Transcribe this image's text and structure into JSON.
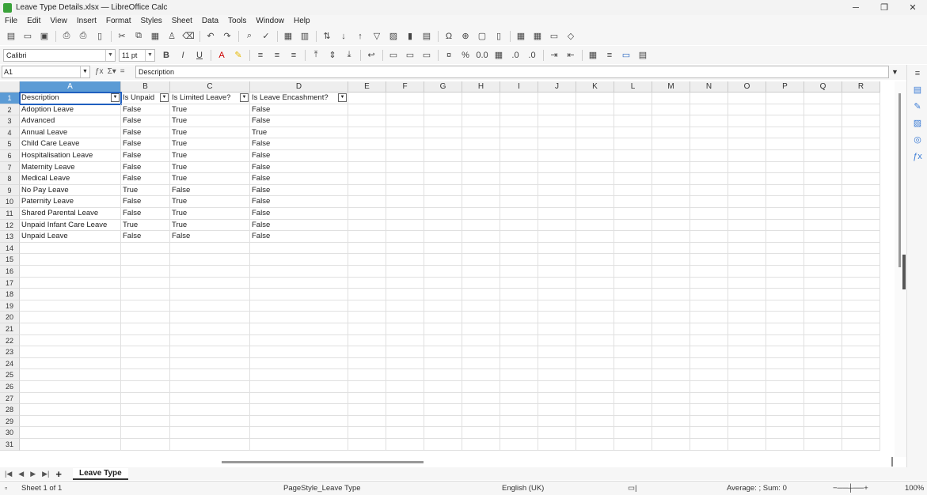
{
  "window": {
    "title": "Leave Type Details.xlsx — LibreOffice Calc"
  },
  "menu": [
    "File",
    "Edit",
    "View",
    "Insert",
    "Format",
    "Styles",
    "Sheet",
    "Data",
    "Tools",
    "Window",
    "Help"
  ],
  "format_bar": {
    "font_name": "Calibri",
    "font_size": "11 pt"
  },
  "formula_bar": {
    "cell_ref": "A1",
    "content": "Description"
  },
  "columns": [
    "A",
    "B",
    "C",
    "D",
    "E",
    "F",
    "G",
    "H",
    "I",
    "J",
    "K",
    "L",
    "M",
    "N",
    "O",
    "P",
    "Q",
    "R"
  ],
  "headers": [
    "Description",
    "Is Unpaid",
    "Is Limited Leave?",
    "Is Leave Encashment?"
  ],
  "rows": [
    [
      "Adoption Leave",
      "False",
      "True",
      "False"
    ],
    [
      "Advanced",
      "False",
      "True",
      "False"
    ],
    [
      "Annual Leave",
      "False",
      "True",
      "True"
    ],
    [
      "Child Care Leave",
      "False",
      "True",
      "False"
    ],
    [
      "Hospitalisation Leave",
      "False",
      "True",
      "False"
    ],
    [
      "Maternity Leave",
      "False",
      "True",
      "False"
    ],
    [
      "Medical Leave",
      "False",
      "True",
      "False"
    ],
    [
      "No Pay Leave",
      "True",
      "False",
      "False"
    ],
    [
      "Paternity Leave",
      "False",
      "True",
      "False"
    ],
    [
      "Shared Parental Leave",
      "False",
      "True",
      "False"
    ],
    [
      "Unpaid Infant Care Leave",
      "True",
      "True",
      "False"
    ],
    [
      "Unpaid Leave",
      "False",
      "False",
      "False"
    ]
  ],
  "row_numbers": [
    "1",
    "2",
    "3",
    "4",
    "5",
    "6",
    "7",
    "8",
    "9",
    "10",
    "11",
    "12",
    "13",
    "14",
    "15",
    "16",
    "17",
    "18",
    "19",
    "20",
    "21",
    "22",
    "23",
    "24",
    "25",
    "26",
    "27",
    "28",
    "29",
    "30",
    "31"
  ],
  "sheet_tab": "Leave Type",
  "status": {
    "sheet": "Sheet 1 of 1",
    "page_style": "PageStyle_Leave Type",
    "language": "English (UK)",
    "summary": "Average: ; Sum: 0",
    "zoom": "100%"
  }
}
